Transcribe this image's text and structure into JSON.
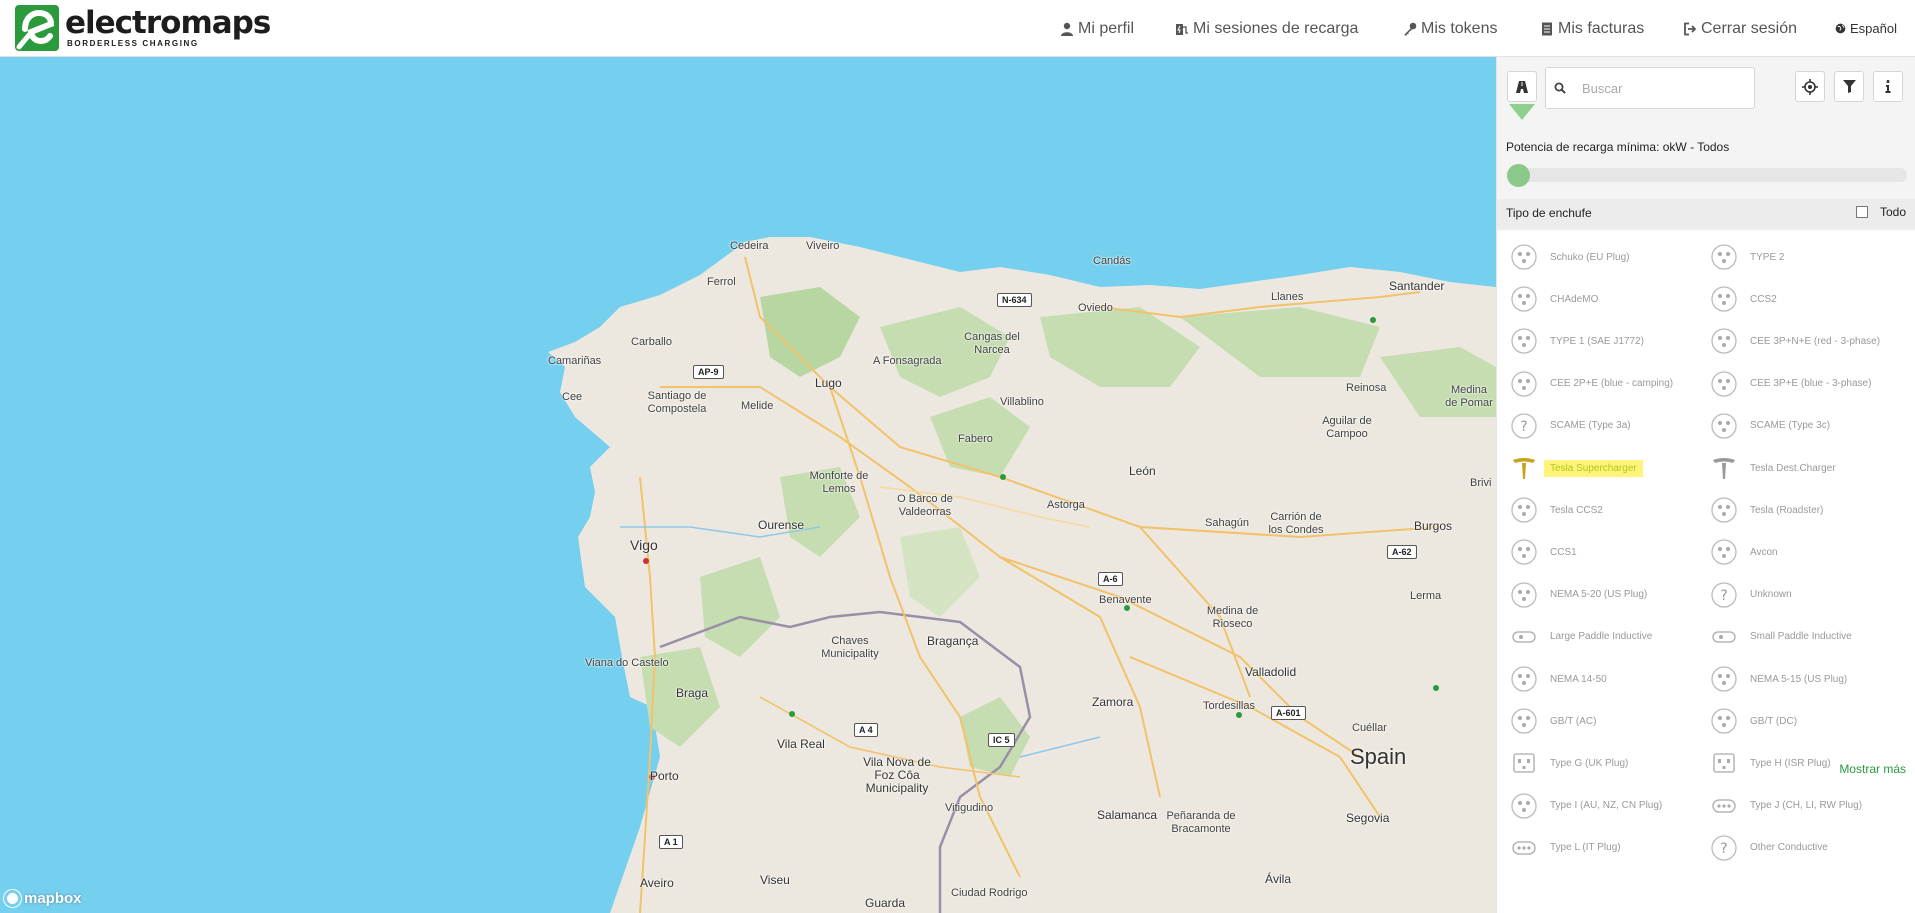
{
  "brand": {
    "name": "electromaps",
    "tagline": "BORDERLESS CHARGING",
    "color": "#2b9a3d"
  },
  "nav": {
    "profile": "Mi perfil",
    "sessions": "Mi sesiones de recarga",
    "tokens": "Mis tokens",
    "invoices": "Mis facturas",
    "logout": "Cerrar sesión",
    "language": "Español"
  },
  "map": {
    "country": "Spain",
    "attribution": "mapbox",
    "places": [
      "Cedeira",
      "Viveiro",
      "Ferrol",
      "Candás",
      "Oviedo",
      "Llanes",
      "Santander",
      "Carballo",
      "Camariñas",
      "Cee",
      "Santiago de Compostela",
      "Melide",
      "Lugo",
      "A Fonsagrada",
      "Cangas del Narcea",
      "Villablino",
      "Reinosa",
      "Medina de Pomar",
      "Aguilar de Campoo",
      "Monforte de Lemos",
      "O Barco de Valdeorras",
      "Fabero",
      "León",
      "Astorga",
      "Sahagún",
      "Carrión de los Condes",
      "Burgos",
      "Ourense",
      "Vigo",
      "Benavente",
      "Medina de Rioseco",
      "Lerma",
      "Viana do Castelo",
      "Chaves Municipality",
      "Bragança",
      "Valladolid",
      "Braga",
      "Vila Real",
      "Vila Nova de Foz Côa Municipality",
      "Zamora",
      "Tordesillas",
      "Cuéllar",
      "Porto",
      "Vitigudino",
      "Salamanca",
      "Peñaranda de Bracamonte",
      "Segovia",
      "Aveiro",
      "Viseu",
      "Guarda",
      "Ciudad Rodrigo",
      "Ávila",
      "Brivi"
    ],
    "roads": [
      "N-634",
      "AP-9",
      "A-6",
      "A-62",
      "A 4",
      "IC 5",
      "A-601",
      "A 1"
    ]
  },
  "panel": {
    "search_placeholder": "Buscar",
    "power_label": "Potencia de recarga mínima: okW - Todos",
    "plug_title": "Tipo de enchufe",
    "all_label": "Todo",
    "more_label": "Mostrar más",
    "plugs_left": [
      "Schuko (EU Plug)",
      "CHAdeMO",
      "TYPE 1 (SAE J1772)",
      "CEE 2P+E (blue - camping)",
      "SCAME (Type 3a)",
      "Tesla Supercharger",
      "Tesla CCS2",
      "CCS1",
      "NEMA 5-20 (US Plug)",
      "Large Paddle Inductive",
      "NEMA 14-50",
      "GB/T (AC)",
      "Type G (UK Plug)",
      "Type I (AU, NZ, CN Plug)",
      "Type L (IT Plug)"
    ],
    "plugs_right": [
      "TYPE 2",
      "CCS2",
      "CEE 3P+N+E (red - 3-phase)",
      "CEE 3P+E (blue - 3-phase)",
      "SCAME (Type 3c)",
      "Tesla Dest.Charger",
      "Tesla (Roadster)",
      "Avcon",
      "Unknown",
      "Small Paddle Inductive",
      "NEMA 5-15 (US Plug)",
      "GB/T (DC)",
      "Type H (ISR Plug)",
      "Type J (CH, LI, RW Plug)",
      "Other Conductive"
    ],
    "highlight_color": "#fff37a"
  }
}
